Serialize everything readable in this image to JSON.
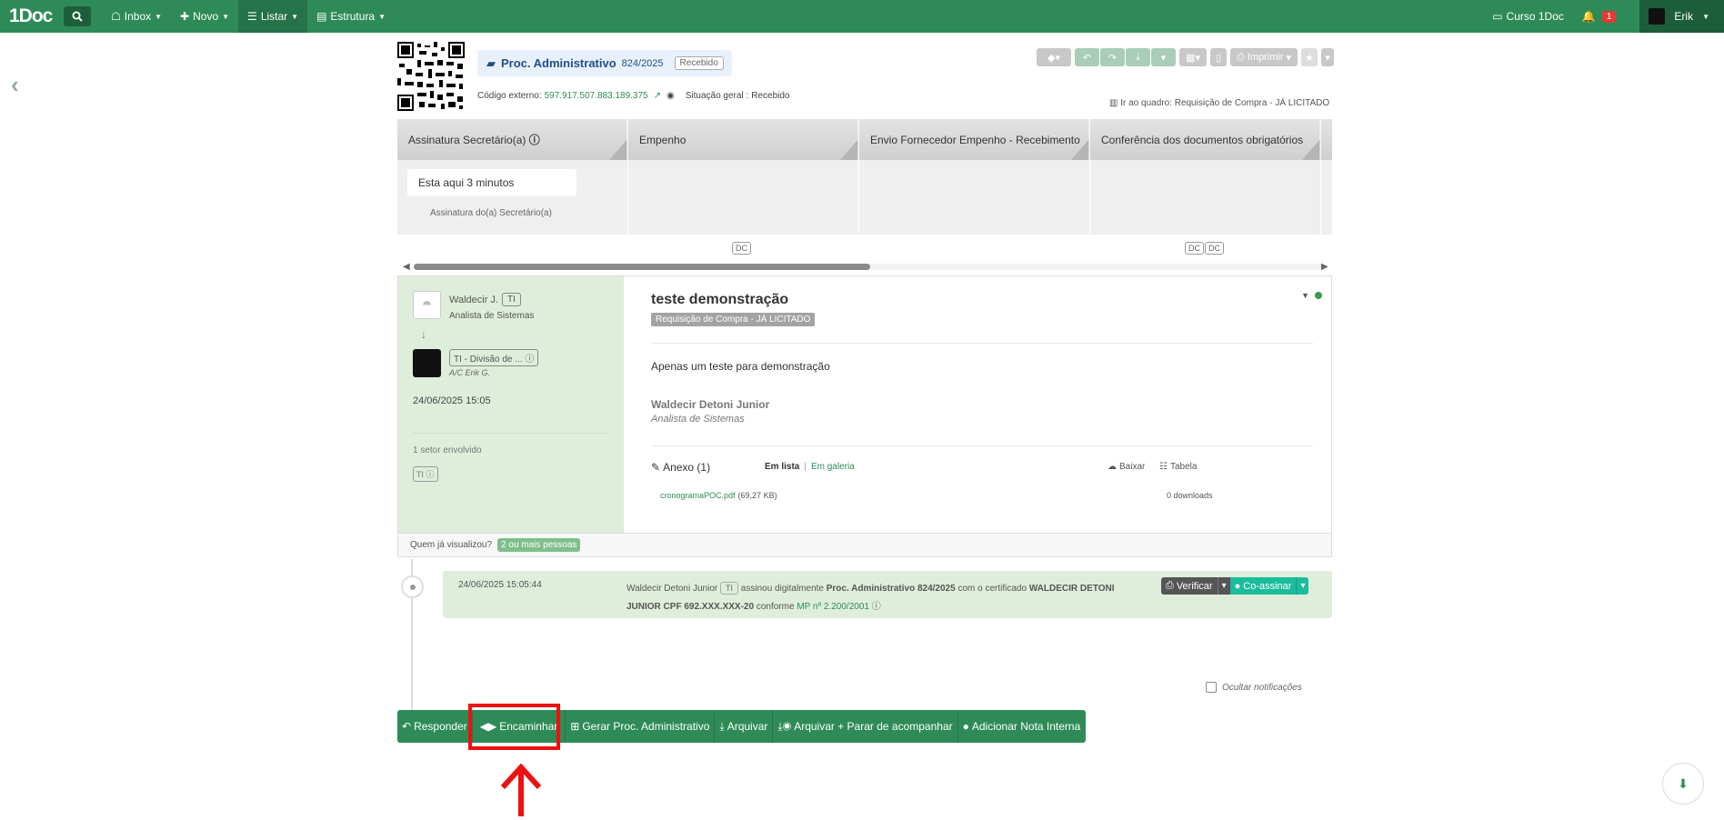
{
  "topbar": {
    "logo": "1Doc",
    "nav": [
      {
        "label": "Inbox",
        "icon": "inbox-icon"
      },
      {
        "label": "Novo",
        "icon": "plus-icon"
      },
      {
        "label": "Listar",
        "icon": "list-icon"
      },
      {
        "label": "Estrutura",
        "icon": "structure-icon"
      }
    ],
    "course_label": "Curso 1Doc",
    "notification_count": "1",
    "user_name": "Erik"
  },
  "document": {
    "title": "Proc. Administrativo",
    "number": "824/2025",
    "status_badge": "Recebido",
    "external_code_label": "Código externo:",
    "external_code": "597.917.507.883.189.375",
    "situation_label": "Situação geral :",
    "situation_value": "Recebido",
    "board_link": "Ir ao quadro: Requisição de Compra - JÁ LICITADO",
    "print_label": "Imprimir"
  },
  "stages": [
    {
      "label": "Assinatura Secretário(a)"
    },
    {
      "label": "Empenho"
    },
    {
      "label": "Envio Fornecedor Empenho - Recebimento"
    },
    {
      "label": "Conferência dos documentos obrigatórios"
    }
  ],
  "stage_current": {
    "time_text": "Esta aqui 3 minutos",
    "sublabel": "Assinatura do(a) Secretário(a)"
  },
  "dc_badge": "DC",
  "message": {
    "sender_name": "Waldecir J.",
    "sender_tag": "TI",
    "sender_role": "Analista de Sistemas",
    "recipient": "TI - Divisão de ...",
    "recipient_ac": "A/C Erik G.",
    "date": "24/06/2025 15:05",
    "sectors_involved": "1 setor envolvido",
    "sector_tag": "TI",
    "subject": "teste demonstração",
    "category_badge": "Requisição de Compra - JÁ LICITADO",
    "body": "Apenas um teste para demonstração",
    "signature_name": "Waldecir Detoni Junior",
    "signature_role": "Analista de Sistemas",
    "attachments_label": "Anexo (1)",
    "view_list": "Em lista",
    "view_separator": "|",
    "view_gallery": "Em galeria",
    "download_label": "Baixar",
    "table_label": "Tabela",
    "file_name": "cronogramaPOC.pdf",
    "file_size": "(69,27 KB)",
    "downloads": "0 downloads",
    "viewed_label": "Quem já visualizou?",
    "viewed_badge": "2 ou mais pessoas"
  },
  "timeline": {
    "timestamp": "24/06/2025 15:05:44",
    "actor": "Waldecir Detoni Junior",
    "actor_tag": "TI",
    "text_1": "assinou digitalmente",
    "doc_ref": "Proc. Administrativo 824/2025",
    "text_2": "com o certificado",
    "cert": "WALDECIR DETONI JUNIOR CPF",
    "cpf": "692.XXX.XXX-20",
    "text_3": "conforme",
    "mp_link": "MP nº 2.200/2001",
    "verify_label": "Verificar",
    "cosign_label": "Co-assinar",
    "hide_notifications": "Ocultar notificações"
  },
  "actions": [
    {
      "label": "Responder",
      "icon": "reply-icon"
    },
    {
      "label": "Encaminhar",
      "icon": "forward-icon"
    },
    {
      "label": "Gerar Proc. Administrativo",
      "icon": "plus-square-icon"
    },
    {
      "label": "Arquivar",
      "icon": "archive-icon"
    },
    {
      "label": "Arquivar + Parar de acompanhar",
      "icon": "archive-eye-icon"
    },
    {
      "label": "Adicionar Nota Interna",
      "icon": "comment-icon"
    }
  ],
  "colors": {
    "brand": "#2e8b57",
    "highlight": "#e11111",
    "panel": "#dfeedb",
    "accent_teal": "#1abc9c"
  }
}
